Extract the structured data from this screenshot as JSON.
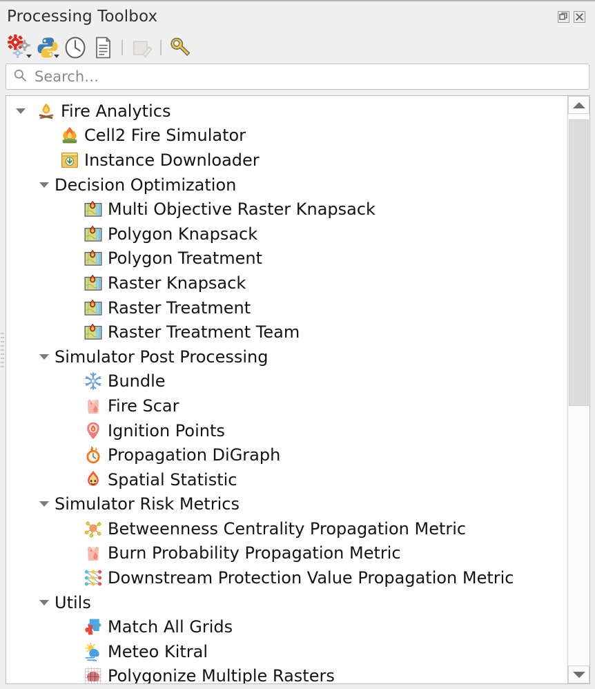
{
  "window": {
    "title": "Processing Toolbox",
    "buttons": [
      {
        "name": "float-button",
        "glyph": "float"
      },
      {
        "name": "close-button",
        "glyph": "close"
      }
    ]
  },
  "toolbar": {
    "items": [
      {
        "name": "models-button",
        "icon": "gears-icon",
        "label": "Models",
        "has_dropdown": true,
        "enabled": true
      },
      {
        "name": "scripts-button",
        "icon": "python-icon",
        "label": "Scripts",
        "has_dropdown": true,
        "enabled": true
      },
      {
        "name": "history-button",
        "icon": "clock-icon",
        "label": "History",
        "has_dropdown": false,
        "enabled": true
      },
      {
        "name": "log-button",
        "icon": "document-icon",
        "label": "Results Log",
        "has_dropdown": false,
        "enabled": true
      },
      {
        "name": "separator-1",
        "icon": "separator",
        "label": "",
        "has_dropdown": false,
        "enabled": true
      },
      {
        "name": "edit-model-button",
        "icon": "edit-model-icon",
        "label": "Edit Model",
        "has_dropdown": false,
        "enabled": false
      },
      {
        "name": "separator-2",
        "icon": "separator",
        "label": "",
        "has_dropdown": false,
        "enabled": true
      },
      {
        "name": "options-button",
        "icon": "wrench-icon",
        "label": "Options",
        "has_dropdown": false,
        "enabled": true
      }
    ]
  },
  "search": {
    "placeholder": "Search…",
    "value": "",
    "icon": "search-icon"
  },
  "tree": {
    "rows": [
      {
        "level": 0,
        "type": "group",
        "expanded": true,
        "icon": "campfire-icon",
        "label": "Fire Analytics"
      },
      {
        "level": 1,
        "type": "algorithm",
        "expanded": null,
        "icon": "fire-icon",
        "label": "Cell2 Fire Simulator"
      },
      {
        "level": 1,
        "type": "algorithm",
        "expanded": null,
        "icon": "download-box-icon",
        "label": "Instance Downloader"
      },
      {
        "level": 1,
        "type": "group",
        "expanded": true,
        "icon": "none",
        "label": "Decision Optimization"
      },
      {
        "level": 2,
        "type": "algorithm",
        "expanded": null,
        "icon": "fire-map-icon",
        "label": "Multi Objective Raster Knapsack"
      },
      {
        "level": 2,
        "type": "algorithm",
        "expanded": null,
        "icon": "fire-map-icon",
        "label": "Polygon Knapsack"
      },
      {
        "level": 2,
        "type": "algorithm",
        "expanded": null,
        "icon": "fire-map-icon",
        "label": "Polygon Treatment"
      },
      {
        "level": 2,
        "type": "algorithm",
        "expanded": null,
        "icon": "fire-map-icon",
        "label": "Raster Knapsack"
      },
      {
        "level": 2,
        "type": "algorithm",
        "expanded": null,
        "icon": "fire-map-icon",
        "label": "Raster Treatment"
      },
      {
        "level": 2,
        "type": "algorithm",
        "expanded": null,
        "icon": "fire-map-icon",
        "label": "Raster Treatment Team"
      },
      {
        "level": 1,
        "type": "group",
        "expanded": true,
        "icon": "none",
        "label": "Simulator Post Processing"
      },
      {
        "level": 2,
        "type": "algorithm",
        "expanded": null,
        "icon": "snowflake-icon",
        "label": "Bundle"
      },
      {
        "level": 2,
        "type": "algorithm",
        "expanded": null,
        "icon": "fire-scar-icon",
        "label": "Fire Scar"
      },
      {
        "level": 2,
        "type": "algorithm",
        "expanded": null,
        "icon": "ignition-pin-icon",
        "label": "Ignition Points"
      },
      {
        "level": 2,
        "type": "algorithm",
        "expanded": null,
        "icon": "fire-clock-icon",
        "label": "Propagation DiGraph"
      },
      {
        "level": 2,
        "type": "algorithm",
        "expanded": null,
        "icon": "fire-face-icon",
        "label": "Spatial Statistic"
      },
      {
        "level": 1,
        "type": "group",
        "expanded": true,
        "icon": "none",
        "label": "Simulator Risk Metrics"
      },
      {
        "level": 2,
        "type": "algorithm",
        "expanded": null,
        "icon": "node-graph-icon",
        "label": "Betweenness Centrality Propagation Metric"
      },
      {
        "level": 2,
        "type": "algorithm",
        "expanded": null,
        "icon": "fire-scar-icon",
        "label": "Burn Probability Propagation Metric"
      },
      {
        "level": 2,
        "type": "algorithm",
        "expanded": null,
        "icon": "network-graph-icon",
        "label": "Downstream Protection Value Propagation Metric"
      },
      {
        "level": 1,
        "type": "group",
        "expanded": true,
        "icon": "none",
        "label": "Utils"
      },
      {
        "level": 2,
        "type": "algorithm",
        "expanded": null,
        "icon": "puzzle-icon",
        "label": "Match All Grids"
      },
      {
        "level": 2,
        "type": "algorithm",
        "expanded": null,
        "icon": "weather-icon",
        "label": "Meteo Kitral"
      },
      {
        "level": 2,
        "type": "algorithm",
        "expanded": null,
        "icon": "grid-mesh-icon",
        "label": "Polygonize Multiple Rasters"
      }
    ]
  },
  "scrollbar": {
    "up_arrow": "scroll-up-arrow",
    "down_arrow": "scroll-down-arrow",
    "thumb_top_pct": 1,
    "thumb_height_pct": 52
  },
  "colors": {
    "panel_bg": "#efefef",
    "tree_bg": "#ffffff",
    "text": "#141414",
    "placeholder": "#8a8a8a",
    "border": "#bdbdbd",
    "fire_orange": "#f0722a",
    "accent_blue": "#6b9fd4"
  }
}
